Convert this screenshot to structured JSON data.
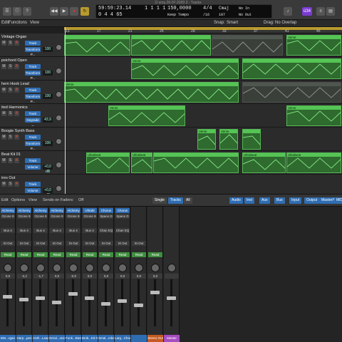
{
  "window_title": "Ū urzą 26-07-2020 2 - Tracks",
  "transport": {
    "position": "59:59:23.14",
    "bars": "0 4 4 65",
    "bar_beat": "1 1 1 1",
    "tempo": "150,0000",
    "tempo_label": "Keep Tempo",
    "signature": "4/4",
    "division": "/16",
    "key": "Cmaj",
    "key2": "107",
    "in_label": "No In",
    "out_label": "No Out",
    "cpu": "ü34"
  },
  "toolbar": {
    "edit": "Edit",
    "functions": "Functions",
    "view": "View",
    "snap": "Snap:",
    "snap_value": "Smart",
    "drag": "Drag:",
    "drag_value": "No Overlap"
  },
  "ruler": [
    "13",
    "17",
    "21",
    "25",
    "29",
    "33",
    "37",
    "41",
    "45"
  ],
  "tracks": [
    {
      "name": "Vintage Organ",
      "plugin": "Transform P...",
      "value": "100"
    },
    {
      "name": "psichord Open",
      "plugin": "Transform P...",
      "value": "100"
    },
    {
      "name": "hem Hook Lead",
      "plugin": "Transform P...",
      "value": "100"
    },
    {
      "name": "ited Harmonics",
      "plugin": "Degrade →",
      "value": "43,9"
    },
    {
      "name": "Boogie Synth Bass",
      "plugin": "Transform P...",
      "value": "100"
    },
    {
      "name": "Beat Kit 01",
      "plugin": "Volume",
      "value": "+0,0 dB"
    },
    {
      "name": "ires Out",
      "plugin": "Volume",
      "value": "+0,0 dB"
    }
  ],
  "regions": [
    {
      "lane": 0,
      "start": 0.0,
      "end": 0.24,
      "label": "",
      "dim": false
    },
    {
      "lane": 0,
      "start": 0.24,
      "end": 0.53,
      "label": "",
      "dim": false
    },
    {
      "lane": 0,
      "start": 0.53,
      "end": 0.79,
      "label": "",
      "dim": true
    },
    {
      "lane": 0,
      "start": 0.8,
      "end": 1.0,
      "label": "Verse",
      "dim": false
    },
    {
      "lane": 1,
      "start": 0.24,
      "end": 0.63,
      "label": "Verse",
      "dim": false
    },
    {
      "lane": 1,
      "start": 0.64,
      "end": 1.0,
      "label": "",
      "dim": false
    },
    {
      "lane": 2,
      "start": 0.0,
      "end": 0.63,
      "label": "Verse",
      "dim": false
    },
    {
      "lane": 2,
      "start": 0.64,
      "end": 1.0,
      "label": "",
      "dim": true
    },
    {
      "lane": 3,
      "start": 0.16,
      "end": 0.44,
      "label": "Verse",
      "dim": false
    },
    {
      "lane": 3,
      "start": 0.8,
      "end": 1.0,
      "label": "Verse",
      "dim": false
    },
    {
      "lane": 4,
      "start": 0.48,
      "end": 0.55,
      "label": "Verse",
      "dim": false
    },
    {
      "lane": 4,
      "start": 0.56,
      "end": 0.63,
      "label": "Verse",
      "dim": false
    },
    {
      "lane": 4,
      "start": 0.64,
      "end": 0.71,
      "label": "",
      "dim": false
    },
    {
      "lane": 5,
      "start": 0.08,
      "end": 0.24,
      "label": "Ultrabeat",
      "dim": false
    },
    {
      "lane": 5,
      "start": 0.24,
      "end": 0.32,
      "label": "Ultrabeat",
      "dim": false
    },
    {
      "lane": 5,
      "start": 0.32,
      "end": 0.63,
      "label": "",
      "dim": false
    },
    {
      "lane": 5,
      "start": 0.64,
      "end": 0.8,
      "label": "Ultrabeat",
      "dim": false
    },
    {
      "lane": 5,
      "start": 0.8,
      "end": 1.0,
      "label": "Ultrabeat",
      "dim": false
    }
  ],
  "mixer_bar": {
    "edit": "Edit",
    "options": "Options",
    "view": "View",
    "sends_on_faders": "Sends on Faders:",
    "sends_value": "Off",
    "tabs": [
      "Single",
      "Tracks",
      "All"
    ],
    "filters": [
      "Audio",
      "Inst",
      "Aux",
      "Bus",
      "Input",
      "Output",
      "Master/VCA",
      "MIDI"
    ]
  },
  "strips": [
    {
      "plug1": "Alchemy",
      "plug2": "Ozone 9",
      "bus": "Bus 4",
      "out": "St Out",
      "auto": "Read",
      "val": "0,0",
      "name": "60s...rgan",
      "color": "#2f6db3"
    },
    {
      "plug1": "Alchemy",
      "plug2": "Ozone 9",
      "bus": "Bus 4",
      "out": "St Out",
      "auto": "Read",
      "val": "-2,2",
      "name": "Harp...pen",
      "color": "#2f6db3"
    },
    {
      "plug1": "Alchemy",
      "plug2": "Ozone 9",
      "bus": "Bus 4",
      "out": "St Out",
      "auto": "Read",
      "val": "-1,7",
      "name": "Anth...Lead",
      "color": "#2f6db3"
    },
    {
      "plug1": "Alchemy",
      "plug2": "Ozone 9",
      "bus": "Bus 4",
      "out": "St Out",
      "auto": "Read",
      "val": "0,0",
      "name": "Deral...onics",
      "color": "#2f6db3"
    },
    {
      "plug1": "Alchemy",
      "plug2": "Ozone 9",
      "bus": "Bus 4",
      "out": "St Out",
      "auto": "Read",
      "val": "-0,9",
      "name": "Funk...Bass",
      "color": "#2f6db3"
    },
    {
      "plug1": "Ultrabt",
      "plug2": "Ozone 9",
      "bus": "Bus 4",
      "out": "St Out",
      "auto": "Read",
      "val": "0,0",
      "name": "Brok...Kit 01",
      "color": "#2f6db3"
    },
    {
      "plug1": "Chorus",
      "plug2": "Space D",
      "bus": "Chan EQ",
      "out": "St Out",
      "auto": "Read",
      "val": "0,0",
      "name": "Smal...mber",
      "color": "#2f6db3"
    },
    {
      "plug1": "Chorus",
      "plug2": "Space D",
      "bus": "Chan EQ",
      "out": "St Out",
      "auto": "Read",
      "val": "0,0",
      "name": "Larg...Chorus",
      "color": "#2f6db3"
    },
    {
      "plug1": "",
      "plug2": "",
      "bus": "",
      "out": "St Out",
      "auto": "Read",
      "val": "0,0",
      "name": "",
      "color": "#2f6db3"
    },
    {
      "plug1": "",
      "plug2": "",
      "bus": "",
      "out": "",
      "auto": "Read",
      "val": "0,0",
      "name": "Stereo Out",
      "color": "#c55a22"
    },
    {
      "plug1": "",
      "plug2": "",
      "bus": "",
      "out": "",
      "auto": "",
      "val": "",
      "name": "Master",
      "color": "#a64dbf"
    }
  ],
  "colors": {
    "region_green": "#2f6a2f",
    "accent_blue": "#2f6db3",
    "cycle_yellow": "#b89a2d"
  }
}
